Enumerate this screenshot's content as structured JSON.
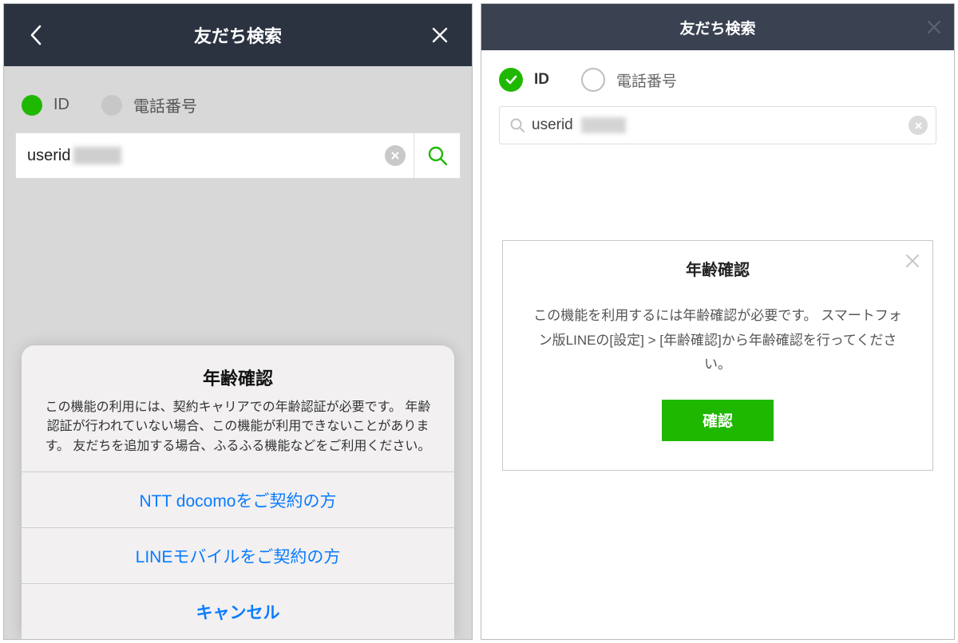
{
  "mobile": {
    "header": {
      "title": "友だち検索"
    },
    "radio": {
      "id_label": "ID",
      "phone_label": "電話番号"
    },
    "search": {
      "value": "userid"
    },
    "sheet": {
      "title": "年齢確認",
      "message": "この機能の利用には、契約キャリアでの年齢認証が必要です。\n年齢認証が行われていない場合、この機能が利用できないことがあります。\n友だちを追加する場合、ふるふる機能などをご利用ください。",
      "options": [
        "NTT docomoをご契約の方",
        "LINEモバイルをご契約の方"
      ],
      "cancel": "キャンセル"
    }
  },
  "desktop": {
    "header": {
      "title": "友だち検索"
    },
    "radio": {
      "id_label": "ID",
      "phone_label": "電話番号"
    },
    "search": {
      "value": "userid"
    },
    "dialog": {
      "title": "年齢確認",
      "message": "この機能を利用するには年齢確認が必要です。\nスマートフォン版LINEの[設定] > [年齢確認]から年齢確認を行ってください。",
      "confirm": "確認"
    }
  },
  "colors": {
    "accent": "#1fb801",
    "link": "#0a7cff",
    "header": "#2b3341"
  }
}
